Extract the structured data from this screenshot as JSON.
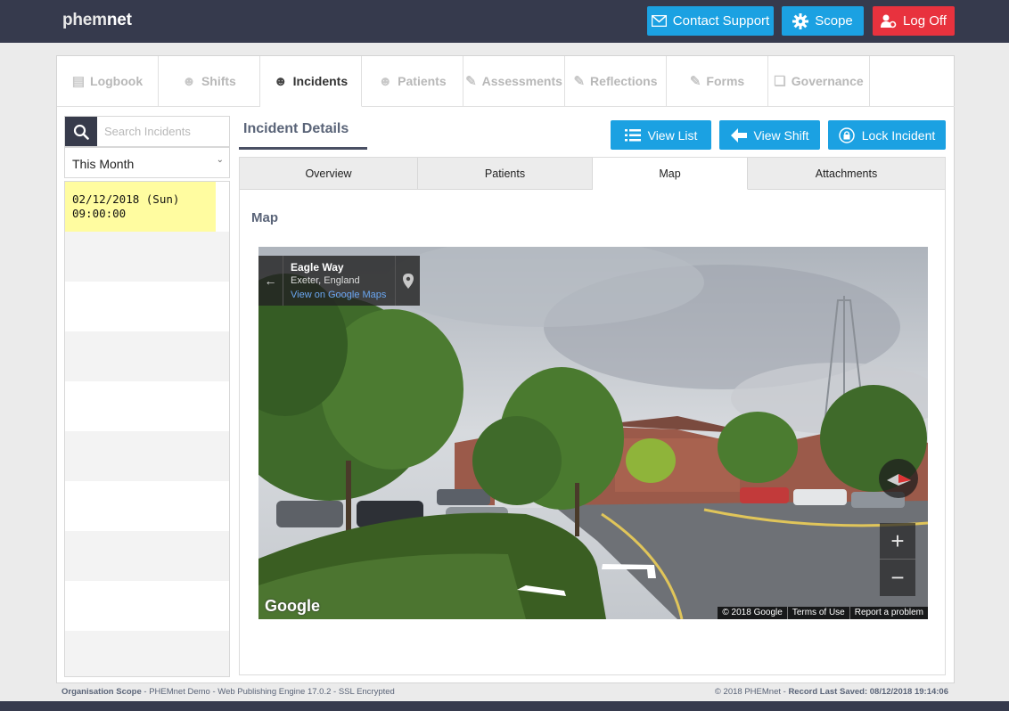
{
  "header": {
    "logo_a": "phem",
    "logo_b": "net",
    "contact_support": "Contact Support",
    "scope": "Scope",
    "log_off": "Log Off"
  },
  "main_tabs": [
    "Logbook",
    "Shifts",
    "Incidents",
    "Patients",
    "Assessments",
    "Reflections",
    "Forms",
    "Governance"
  ],
  "active_main_tab": "Incidents",
  "left_panel": {
    "search_placeholder": "Search Incidents",
    "period": "This Month",
    "incidents": [
      {
        "date": "02/12/2018 (Sun)",
        "time": "09:00:00"
      }
    ]
  },
  "detail": {
    "title": "Incident Details",
    "view_list": "View List",
    "view_shift": "View Shift",
    "lock_incident": "Lock Incident",
    "sub_tabs": [
      "Overview",
      "Patients",
      "Map",
      "Attachments"
    ],
    "active_sub_tab": "Map",
    "section_title": "Map"
  },
  "street_view": {
    "street": "Eagle Way",
    "city": "Exeter, England",
    "link": "View on Google Maps",
    "logo": "Google",
    "credits": [
      "© 2018 Google",
      "Terms of Use",
      "Report a problem"
    ],
    "zoom_in": "+",
    "zoom_out": "−"
  },
  "footer": {
    "left_bold": "Organisation Scope",
    "left_rest": " - PHEMnet Demo - Web Publishing Engine 17.0.2 - SSL Encrypted",
    "right_plain": "© 2018 PHEMnet - ",
    "right_bold": "Record Last Saved: 08/12/2018 19:14:06"
  },
  "colors": {
    "topbar": "#363a4d",
    "accent_blue": "#1ba1e2",
    "danger_red": "#e8323e",
    "selected_row": "#fffca0"
  }
}
